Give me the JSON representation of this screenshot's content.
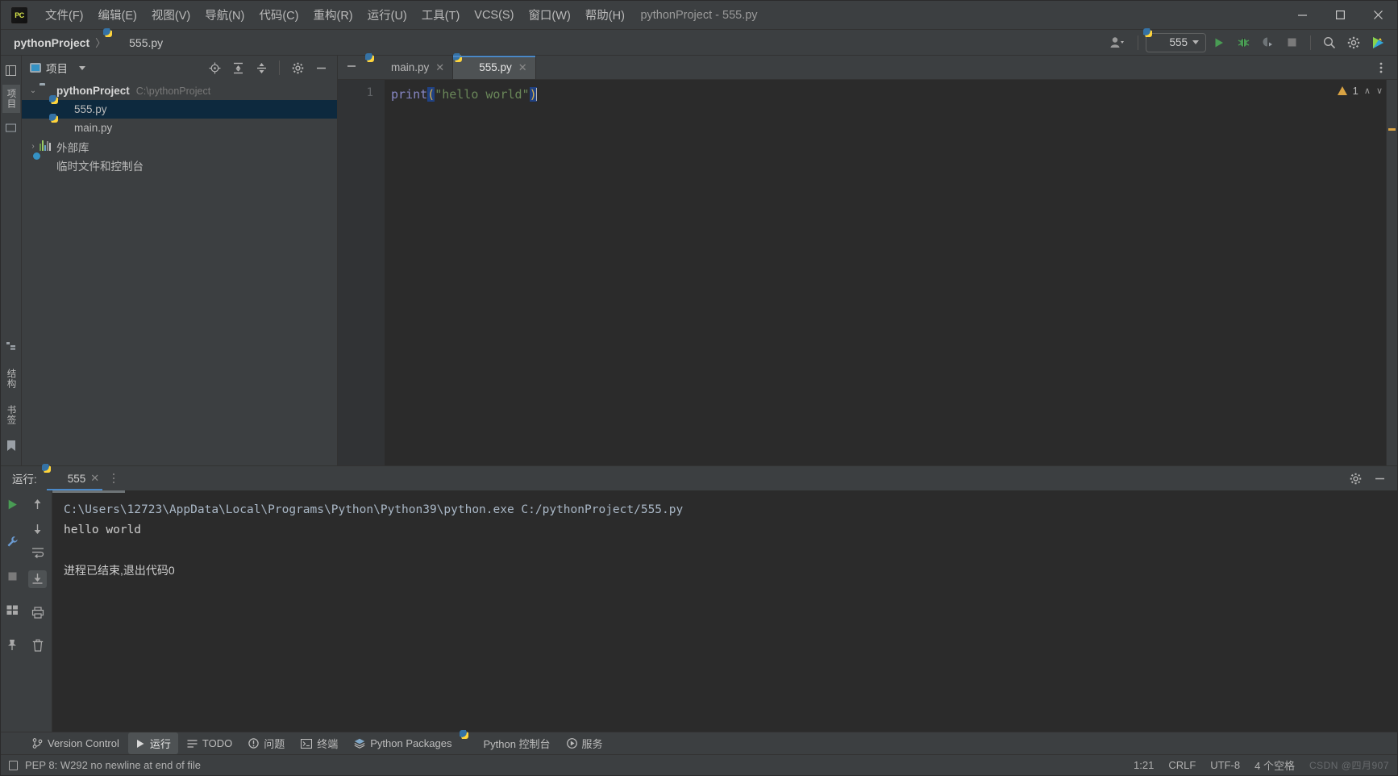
{
  "window": {
    "title": "pythonProject - 555.py",
    "logo_text": "PC",
    "minimize": "–",
    "maximize": "☐",
    "close": "✕"
  },
  "menu": [
    {
      "label": "文件(F)",
      "name": "menu-file"
    },
    {
      "label": "编辑(E)",
      "name": "menu-edit"
    },
    {
      "label": "视图(V)",
      "name": "menu-view"
    },
    {
      "label": "导航(N)",
      "name": "menu-navigate"
    },
    {
      "label": "代码(C)",
      "name": "menu-code"
    },
    {
      "label": "重构(R)",
      "name": "menu-refactor"
    },
    {
      "label": "运行(U)",
      "name": "menu-run"
    },
    {
      "label": "工具(T)",
      "name": "menu-tools"
    },
    {
      "label": "VCS(S)",
      "name": "menu-vcs"
    },
    {
      "label": "窗口(W)",
      "name": "menu-window"
    },
    {
      "label": "帮助(H)",
      "name": "menu-help"
    }
  ],
  "breadcrumb": {
    "project": "pythonProject",
    "separator": "〉",
    "file": "555.py"
  },
  "toolbar": {
    "run_config_name": "555",
    "run_icon": "run-icon",
    "debug_icon": "debug-icon",
    "coverage_icon": "run-with-coverage-icon",
    "stop_icon": "stop-icon",
    "search_icon": "search-icon",
    "settings_icon": "settings-icon",
    "ai_icon": "ai-assistant-icon",
    "account_icon": "account-icon"
  },
  "left_strip": {
    "tabs": [
      "项目",
      "结构",
      "书签"
    ],
    "active": "项目"
  },
  "project_panel": {
    "title": "项目",
    "tools": [
      "locate-icon",
      "expand-all-icon",
      "collapse-all-icon",
      "settings-icon",
      "hide-icon"
    ],
    "tree": [
      {
        "label": "pythonProject",
        "path": "C:\\pythonProject",
        "icon": "folder-icon",
        "indent": 0,
        "twisty": "⌄",
        "bold": true,
        "selected": false
      },
      {
        "label": "555.py",
        "path": "",
        "icon": "python-file-icon",
        "indent": 2,
        "twisty": "",
        "bold": false,
        "selected": true
      },
      {
        "label": "main.py",
        "path": "",
        "icon": "python-file-icon",
        "indent": 2,
        "twisty": "",
        "bold": false,
        "selected": false
      },
      {
        "label": "外部库",
        "path": "",
        "icon": "library-icon",
        "indent": 0,
        "twisty": "›",
        "bold": false,
        "selected": false
      },
      {
        "label": "临时文件和控制台",
        "path": "",
        "icon": "scratch-icon",
        "indent": 1,
        "twisty": "",
        "bold": false,
        "selected": false
      }
    ]
  },
  "editor": {
    "tabs": [
      {
        "label": "main.py",
        "active": false,
        "close": "✕"
      },
      {
        "label": "555.py",
        "active": true,
        "close": "✕"
      }
    ],
    "line_numbers": [
      "1"
    ],
    "code": {
      "fn": "print",
      "open_paren": "(",
      "string": "\"hello world\"",
      "close_paren": ")"
    },
    "inspection": {
      "warning_count": "1",
      "up_chevron": "∧",
      "down_chevron": "∨",
      "hide_icon": "—"
    }
  },
  "run_panel": {
    "label": "运行:",
    "tab_name": "555",
    "tab_close": "✕",
    "more_icon": "more-options-icon",
    "settings_icon": "settings-icon",
    "hide_icon": "hide-icon",
    "gutter_icons": [
      "rerun-icon",
      "wrench-icon",
      "stop-icon",
      "layout-icon",
      "pin-icon"
    ],
    "gutter_icons2": [
      "scroll-up-icon",
      "scroll-down-icon",
      "soft-wrap-icon",
      "scroll-to-end-icon",
      "print-icon",
      "trash-icon"
    ],
    "console": {
      "command": "C:\\Users\\12723\\AppData\\Local\\Programs\\Python\\Python39\\python.exe C:/pythonProject/555.py",
      "output": "hello world",
      "exit_message": "进程已结束,退出代码0"
    }
  },
  "bottom_bar": [
    {
      "label": "Version Control",
      "icon": "branch-icon",
      "active": false,
      "name": "bottom-tab-version-control"
    },
    {
      "label": "运行",
      "icon": "run-icon",
      "active": true,
      "name": "bottom-tab-run"
    },
    {
      "label": "TODO",
      "icon": "todo-icon",
      "active": false,
      "name": "bottom-tab-todo"
    },
    {
      "label": "问题",
      "icon": "problems-icon",
      "active": false,
      "name": "bottom-tab-problems"
    },
    {
      "label": "终端",
      "icon": "terminal-icon",
      "active": false,
      "name": "bottom-tab-terminal"
    },
    {
      "label": "Python Packages",
      "icon": "packages-icon",
      "active": false,
      "name": "bottom-tab-python-packages"
    },
    {
      "label": "Python 控制台",
      "icon": "python-console-icon",
      "active": false,
      "name": "bottom-tab-python-console"
    },
    {
      "label": "服务",
      "icon": "services-icon",
      "active": false,
      "name": "bottom-tab-services"
    }
  ],
  "status_bar": {
    "message": "PEP 8: W292 no newline at end of file",
    "caret_position": "1:21",
    "line_separator": "CRLF",
    "encoding": "UTF-8",
    "indent": "4 个空格",
    "watermark": "CSDN @四月907"
  }
}
